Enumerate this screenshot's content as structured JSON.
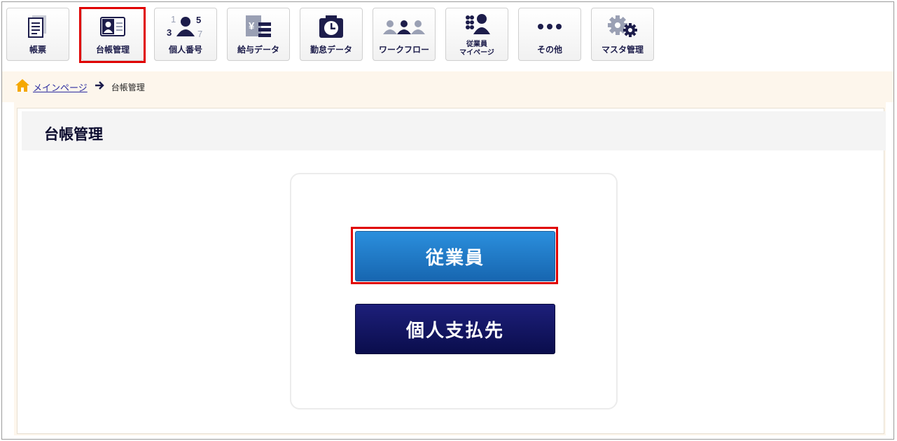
{
  "toolbar": {
    "items": [
      {
        "label": "帳票",
        "icon": "document-icon"
      },
      {
        "label": "台帳管理",
        "icon": "ledger-card-icon"
      },
      {
        "label": "個人番号",
        "icon": "personal-number-icon"
      },
      {
        "label": "給与データ",
        "icon": "salary-data-icon"
      },
      {
        "label": "勤怠データ",
        "icon": "attendance-clock-icon"
      },
      {
        "label": "ワークフロー",
        "icon": "workflow-users-icon"
      },
      {
        "label": "従業員\nマイページ",
        "icon": "employee-mypage-icon"
      },
      {
        "label": "その他",
        "icon": "more-dots-icon"
      },
      {
        "label": "マスタ管理",
        "icon": "gears-icon"
      }
    ],
    "selected": "台帳管理"
  },
  "breadcrumb": {
    "home_link": "メインページ",
    "current": "台帳管理"
  },
  "main": {
    "title": "台帳管理",
    "buttons": {
      "employee": "従業員",
      "payee": "個人支払先"
    }
  },
  "colors": {
    "highlight": "#e00000",
    "primary_blue": "#1f7acb",
    "navy": "#12145e",
    "breadcrumb_bg": "#fdf6ec"
  }
}
